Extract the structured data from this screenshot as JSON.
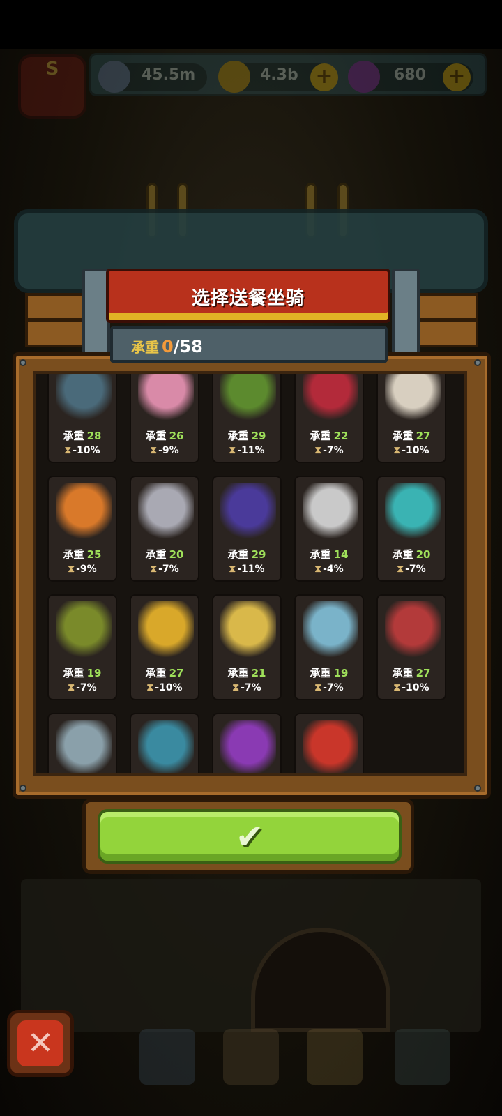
{
  "hud": {
    "badge_letter": "S",
    "resource1": "45.5m",
    "resource2": "4.3b",
    "resource3": "680"
  },
  "dialog": {
    "title": "选择送餐坐骑",
    "capacity_label": "承重",
    "capacity_current": "0",
    "capacity_max": "/58"
  },
  "labels": {
    "capacity": "承重"
  },
  "mounts": [
    {
      "capacity": "28",
      "speed": "-10%",
      "color": "#4a6a7a"
    },
    {
      "capacity": "26",
      "speed": "-9%",
      "color": "#d98aa8"
    },
    {
      "capacity": "29",
      "speed": "-11%",
      "color": "#5c8a2e"
    },
    {
      "capacity": "22",
      "speed": "-7%",
      "color": "#b32a3a"
    },
    {
      "capacity": "27",
      "speed": "-10%",
      "color": "#d8cfc0"
    },
    {
      "capacity": "25",
      "speed": "-9%",
      "color": "#d9792a"
    },
    {
      "capacity": "20",
      "speed": "-7%",
      "color": "#a9a9b3"
    },
    {
      "capacity": "29",
      "speed": "-11%",
      "color": "#4a3a9a"
    },
    {
      "capacity": "14",
      "speed": "-4%",
      "color": "#c9c9c9"
    },
    {
      "capacity": "20",
      "speed": "-7%",
      "color": "#3ab3b3"
    },
    {
      "capacity": "19",
      "speed": "-7%",
      "color": "#7a8a2a"
    },
    {
      "capacity": "27",
      "speed": "-10%",
      "color": "#d9a82a"
    },
    {
      "capacity": "21",
      "speed": "-7%",
      "color": "#d9b84a"
    },
    {
      "capacity": "19",
      "speed": "-7%",
      "color": "#7ab3c9"
    },
    {
      "capacity": "27",
      "speed": "-10%",
      "color": "#b33a3a"
    },
    {
      "capacity": "",
      "speed": "",
      "color": "#8aa0aa"
    },
    {
      "capacity": "",
      "speed": "",
      "color": "#3a8aa0"
    },
    {
      "capacity": "",
      "speed": "",
      "color": "#8a3ab3"
    },
    {
      "capacity": "",
      "speed": "",
      "color": "#c9362a"
    }
  ],
  "icons": {
    "speed": "hourglass-icon",
    "confirm": "checkmark-icon",
    "close": "close-icon"
  },
  "colors": {
    "accent_green": "#93d43b",
    "banner_red": "#b8311c",
    "capacity_value": "#9fe05a",
    "capacity_current": "#f39a3a"
  }
}
